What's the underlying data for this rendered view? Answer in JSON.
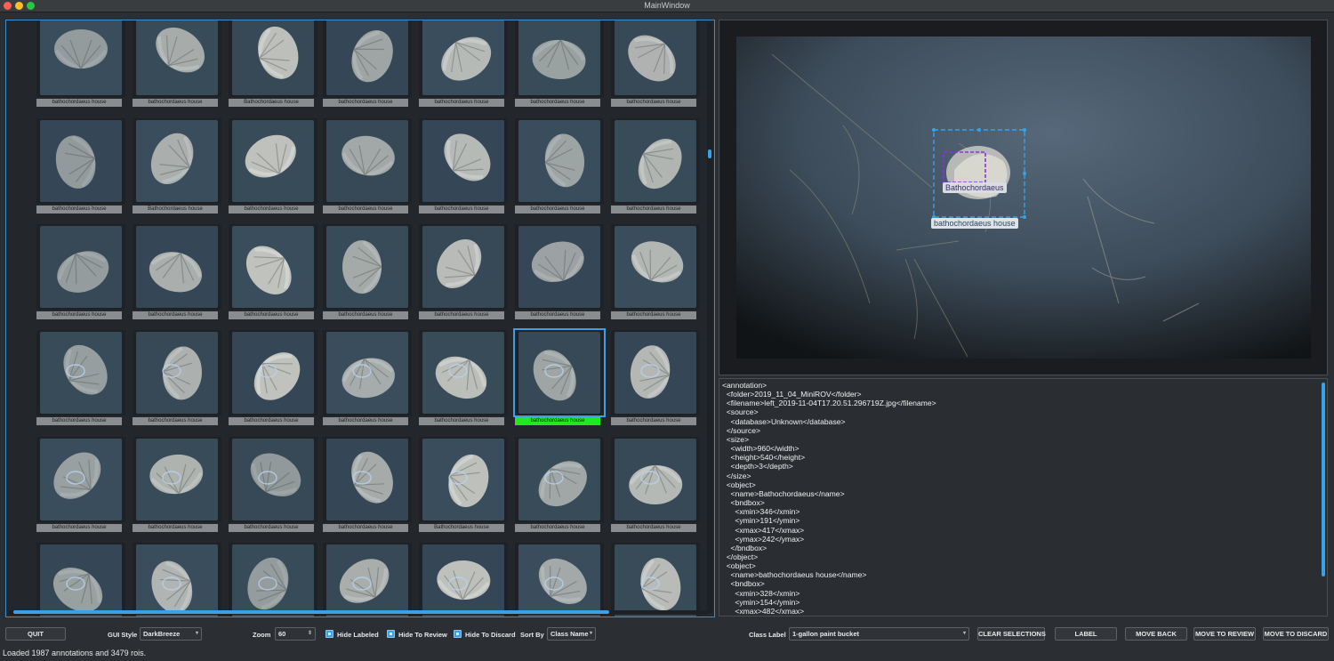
{
  "window": {
    "title": "MainWindow"
  },
  "grid": {
    "selected_index": 26,
    "rows": [
      [
        "bathochordaeus house",
        "bathochordaeus house",
        "Bathochordaeus house",
        "bathochordaeus house",
        "bathochordaeus house",
        "bathochordaeus house",
        "bathochordaeus house"
      ],
      [
        "bathochordaeus house",
        "Bathochordaeus house",
        "bathochordaeus house",
        "bathochordaeus house",
        "bathochordaeus house",
        "bathochordaeus house",
        "bathochordaeus house"
      ],
      [
        "bathochordaeus house",
        "bathochordaeus house",
        "bathochordaeus house",
        "bathochordaeus house",
        "bathochordaeus house",
        "bathochordaeus house",
        "bathochordaeus house"
      ],
      [
        "bathochordaeus house",
        "bathochordaeus house",
        "bathochordaeus house",
        "bathochordaeus house",
        "bathochordaeus house",
        "bathochordaeus house",
        "bathochordaeus house"
      ],
      [
        "bathochordaeus house",
        "bathochordaeus house",
        "bathochordaeus house",
        "bathochordaeus house",
        "Bathochordaeus house",
        "bathochordaeus house",
        "bathochordaeus house"
      ],
      [
        "",
        "",
        "",
        "",
        "",
        "",
        ""
      ]
    ]
  },
  "viewer": {
    "labels": [
      "Bathochordaeus",
      "bathochordaeus house"
    ]
  },
  "xml_text": "<annotation>\n  <folder>2019_11_04_MiniROV</folder>\n  <filename>left_2019-11-04T17.20.51.296719Z.jpg</filename>\n  <source>\n    <database>Unknown</database>\n  </source>\n  <size>\n    <width>960</width>\n    <height>540</height>\n    <depth>3</depth>\n  </size>\n  <object>\n    <name>Bathochordaeus</name>\n    <bndbox>\n      <xmin>346</xmin>\n      <ymin>191</ymin>\n      <xmax>417</xmax>\n      <ymax>242</ymax>\n    </bndbox>\n  </object>\n  <object>\n    <name>bathochordaeus house</name>\n    <bndbox>\n      <xmin>328</xmin>\n      <ymin>154</ymin>\n      <xmax>482</xmax>",
  "toolbar": {
    "quit": "QUIT",
    "gui_style_label": "GUI Style",
    "gui_style_value": "DarkBreeze",
    "zoom_label": "Zoom",
    "zoom_value": "60",
    "hide_labeled": "Hide Labeled",
    "hide_to_review": "Hide To Review",
    "hide_to_discard": "Hide To Discard",
    "sort_by_label": "Sort By",
    "sort_by_value": "Class Name",
    "class_label": "Class Label",
    "class_value": "1-gallon paint bucket",
    "clear_selections": "CLEAR SELECTIONS",
    "label": "LABEL",
    "move_back": "MOVE BACK",
    "move_to_review": "MOVE TO REVIEW",
    "move_to_discard": "MOVE TO DISCARD"
  },
  "status": "Loaded 1987 annotations and 3479 rois."
}
